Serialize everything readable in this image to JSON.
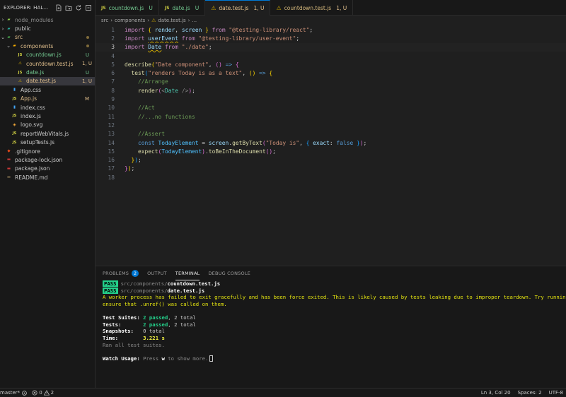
{
  "explorer": {
    "title": "EXPLORER: HAL...",
    "tree": [
      {
        "name": "node_modules",
        "type": "folder",
        "depth": 0,
        "expanded": false,
        "icon": "node-folder-icon",
        "color": "muted",
        "badge": ""
      },
      {
        "name": "public",
        "type": "folder",
        "depth": 0,
        "expanded": false,
        "icon": "public-folder-icon",
        "color": "normal",
        "badge": ""
      },
      {
        "name": "src",
        "type": "folder",
        "depth": 0,
        "expanded": true,
        "icon": "src-folder-icon",
        "color": "yellow",
        "badge": "dot"
      },
      {
        "name": "components",
        "type": "folder",
        "depth": 1,
        "expanded": true,
        "icon": "components-folder-icon",
        "color": "yellow",
        "badge": "dot"
      },
      {
        "name": "countdown.js",
        "type": "js",
        "depth": 2,
        "color": "green",
        "badge": "U"
      },
      {
        "name": "countdown.test.js",
        "type": "test",
        "depth": 2,
        "color": "yellow",
        "badge": "1, U"
      },
      {
        "name": "date.js",
        "type": "js",
        "depth": 2,
        "color": "green",
        "badge": "U"
      },
      {
        "name": "date.test.js",
        "type": "test",
        "depth": 2,
        "color": "yellow",
        "badge": "1, U",
        "selected": true
      },
      {
        "name": "App.css",
        "type": "css",
        "depth": 1,
        "color": "normal",
        "badge": ""
      },
      {
        "name": "App.js",
        "type": "js",
        "depth": 1,
        "color": "yellow",
        "badge": "M"
      },
      {
        "name": "index.css",
        "type": "css",
        "depth": 1,
        "color": "normal",
        "badge": ""
      },
      {
        "name": "index.js",
        "type": "js",
        "depth": 1,
        "color": "normal",
        "badge": ""
      },
      {
        "name": "logo.svg",
        "type": "svg",
        "depth": 1,
        "color": "normal",
        "badge": ""
      },
      {
        "name": "reportWebVitals.js",
        "type": "js",
        "depth": 1,
        "color": "normal",
        "badge": ""
      },
      {
        "name": "setupTests.js",
        "type": "js",
        "depth": 1,
        "color": "normal",
        "badge": ""
      },
      {
        "name": ".gitignore",
        "type": "git",
        "depth": 0,
        "color": "normal",
        "badge": ""
      },
      {
        "name": "package-lock.json",
        "type": "npm",
        "depth": 0,
        "color": "normal",
        "badge": ""
      },
      {
        "name": "package.json",
        "type": "npm",
        "depth": 0,
        "color": "normal",
        "badge": ""
      },
      {
        "name": "README.md",
        "type": "md",
        "depth": 0,
        "color": "normal",
        "badge": ""
      }
    ]
  },
  "tabs": [
    {
      "label": "countdown.js",
      "kind": "js",
      "status": "U",
      "active": false
    },
    {
      "label": "date.js",
      "kind": "js",
      "status": "U",
      "active": false
    },
    {
      "label": "date.test.js",
      "kind": "test",
      "status": "1, U",
      "active": true
    },
    {
      "label": "countdown.test.js",
      "kind": "test",
      "status": "1, U",
      "active": false
    }
  ],
  "breadcrumb": {
    "part1": "src",
    "part2": "components",
    "file": "date.test.js",
    "more": "..."
  },
  "editor": {
    "current_line": 3,
    "lines": [
      [
        [
          "import ",
          "kw"
        ],
        [
          "{ ",
          "p1"
        ],
        [
          "render",
          "var"
        ],
        [
          ", ",
          "punc"
        ],
        [
          "screen",
          "var"
        ],
        [
          " } ",
          "p1"
        ],
        [
          "from ",
          "kw"
        ],
        [
          "\"@testing-library/react\"",
          "str"
        ],
        [
          ";",
          "punc"
        ]
      ],
      [
        [
          "import ",
          "kw"
        ],
        [
          "userEvent",
          "var",
          "squig"
        ],
        [
          " from ",
          "kw"
        ],
        [
          "\"@testing-library/user-event\"",
          "str"
        ],
        [
          ";",
          "punc"
        ]
      ],
      [
        [
          "import ",
          "kw"
        ],
        [
          "Date",
          "var",
          "squig"
        ],
        [
          " from ",
          "kw"
        ],
        [
          "\"./date\"",
          "str"
        ],
        [
          ";",
          "punc"
        ]
      ],
      [],
      [
        [
          "describe",
          "fn"
        ],
        [
          "(",
          "p1"
        ],
        [
          "\"Date component\"",
          "str"
        ],
        [
          ", ",
          "punc"
        ],
        [
          "() ",
          "p2"
        ],
        [
          "=> ",
          "dec"
        ],
        [
          "{",
          "p2"
        ]
      ],
      [
        [
          "  test",
          "fn"
        ],
        [
          "(",
          "p3"
        ],
        [
          "\"renders Today is as a text\"",
          "str"
        ],
        [
          ", ",
          "punc"
        ],
        [
          "() ",
          "p1"
        ],
        [
          "=> ",
          "dec"
        ],
        [
          "{",
          "p1"
        ]
      ],
      [
        [
          "    //Arrange",
          "cm"
        ]
      ],
      [
        [
          "    render",
          "fn"
        ],
        [
          "(",
          "p2"
        ],
        [
          "<",
          "dim"
        ],
        [
          "Date",
          "tag"
        ],
        [
          " />",
          "dim"
        ],
        [
          ")",
          "p2"
        ],
        [
          ";",
          "punc"
        ]
      ],
      [],
      [
        [
          "    //Act",
          "cm"
        ]
      ],
      [
        [
          "    //...no functions",
          "cm"
        ]
      ],
      [],
      [
        [
          "    //Assert",
          "cm"
        ]
      ],
      [
        [
          "    const ",
          "dec"
        ],
        [
          "TodayElement",
          "const"
        ],
        [
          " = ",
          "punc"
        ],
        [
          "screen",
          "var"
        ],
        [
          ".",
          "punc"
        ],
        [
          "getByText",
          "fn"
        ],
        [
          "(",
          "p2"
        ],
        [
          "\"Today is\"",
          "str"
        ],
        [
          ", ",
          "punc"
        ],
        [
          "{ ",
          "p3"
        ],
        [
          "exact",
          "var"
        ],
        [
          ": ",
          "punc"
        ],
        [
          "false",
          "dec"
        ],
        [
          " }",
          "p3"
        ],
        [
          ")",
          "p2"
        ],
        [
          ";",
          "punc"
        ]
      ],
      [
        [
          "    expect",
          "fn"
        ],
        [
          "(",
          "p2"
        ],
        [
          "TodayElement",
          "const"
        ],
        [
          ")",
          "p2"
        ],
        [
          ".",
          "punc"
        ],
        [
          "toBeInTheDocument",
          "fn"
        ],
        [
          "()",
          "p2"
        ],
        [
          ";",
          "punc"
        ]
      ],
      [
        [
          "  }",
          "p1"
        ],
        [
          ")",
          "p3"
        ],
        [
          ";",
          "punc"
        ]
      ],
      [
        [
          "}",
          "p2"
        ],
        [
          ")",
          "p1"
        ],
        [
          ";",
          "punc"
        ]
      ],
      []
    ]
  },
  "panel": {
    "tabs": [
      {
        "label": "PROBLEMS",
        "count": "2",
        "active": false
      },
      {
        "label": "OUTPUT",
        "count": "",
        "active": false
      },
      {
        "label": "TERMINAL",
        "count": "",
        "active": true
      },
      {
        "label": "DEBUG CONSOLE",
        "count": "",
        "active": false
      }
    ],
    "terminal": {
      "pass_label": "PASS",
      "pass1_dir": "src/components/",
      "pass1_file": "countdown.test.js",
      "pass2_dir": "src/components/",
      "pass2_file": "date.test.js",
      "warning_line1": "A worker process has failed to exit gracefully and has been force exited. This is likely caused by tests leaking due to improper teardown. Try running with --detectOp",
      "warning_line2": "ensure that .unref() was called on them.",
      "suites_label": "Test Suites: ",
      "suites_passed": "2 passed",
      "suites_total": ", 2 total",
      "tests_label": "Tests:       ",
      "tests_passed": "2 passed",
      "tests_total": ", 2 total",
      "snap_label": "Snapshots:   ",
      "snap_value": "0 total",
      "time_label": "Time:        ",
      "time_value": "3.221 s",
      "ran_all": "Ran all test suites.",
      "watch_label": "Watch Usage: ",
      "watch_text1": "Press ",
      "watch_key": "w",
      "watch_text2": " to show more."
    }
  },
  "statusbar": {
    "branch": "master*",
    "errors": "0",
    "warnings": "2",
    "position": "Ln 3, Col 20",
    "spaces": "Spaces: 2",
    "encoding": "UTF-8"
  }
}
